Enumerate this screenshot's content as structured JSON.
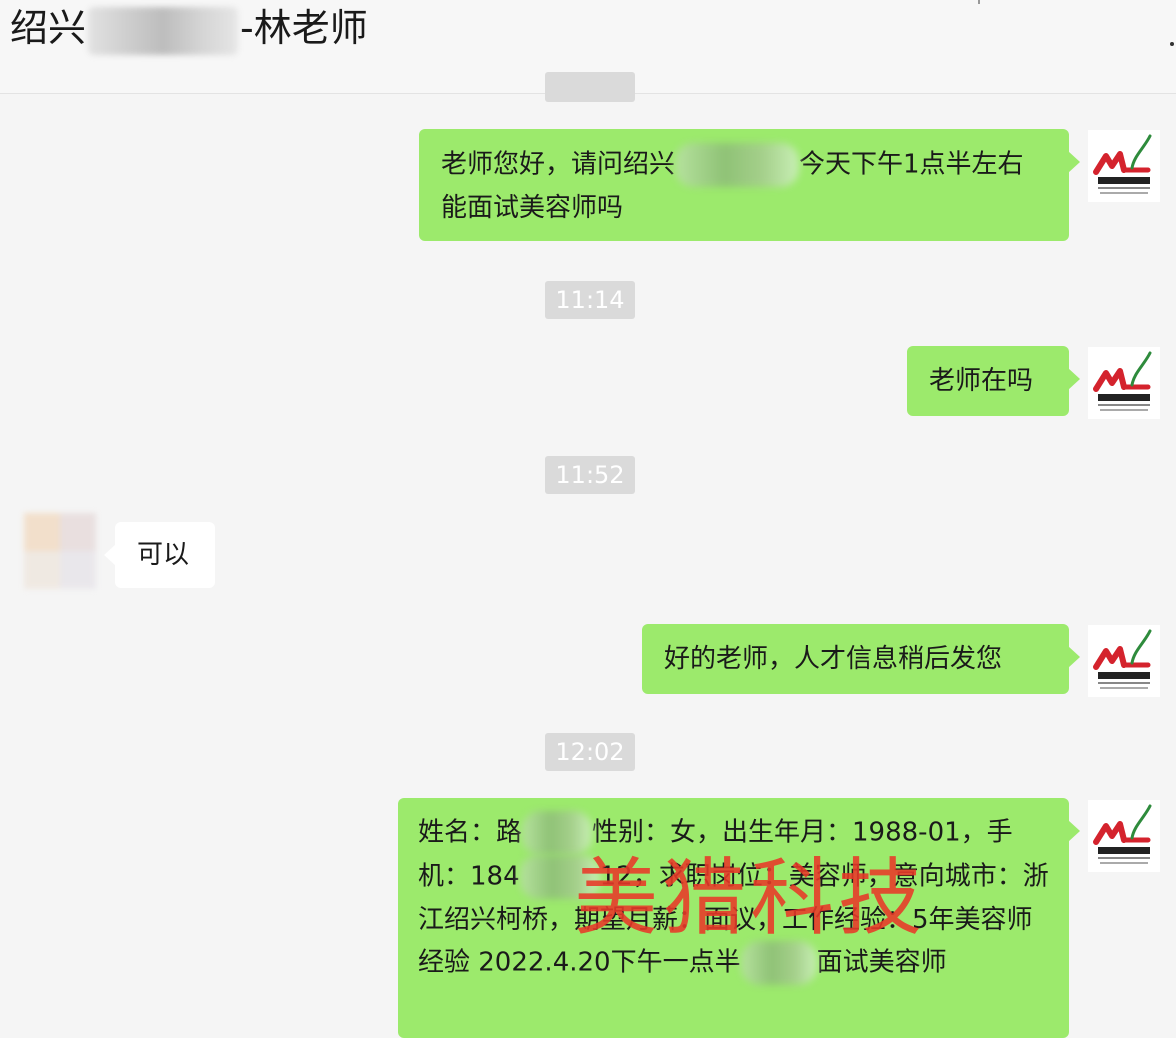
{
  "header": {
    "title_prefix": "绍兴",
    "title_suffix": "-林老师"
  },
  "timestamps": [
    "11:14",
    "11:52",
    "12:02"
  ],
  "messages": {
    "m1": {
      "part1": "老师您好，请问绍兴",
      "part2": "今天下午1点半左右能面试美容师吗"
    },
    "m2": {
      "text": "老师在吗"
    },
    "m3": {
      "text": "可以"
    },
    "m4": {
      "text": "好的老师，人才信息稍后发您"
    },
    "m5": {
      "part1": "姓名：路",
      "part2": "性别：女，出生年月：1988-01，手机：184",
      "part3": "12，求职岗位：美容师，意向城市：浙江绍兴柯桥，期望月薪：面议，工作经验：5年美容师经验 2022.4.20下午一点半",
      "part4": "面试美容师"
    }
  },
  "avatar": {
    "logo_letters": "ML",
    "logo_colors": {
      "red": "#d4232d",
      "green": "#2e8b3c"
    }
  },
  "watermark": "美猎科技"
}
